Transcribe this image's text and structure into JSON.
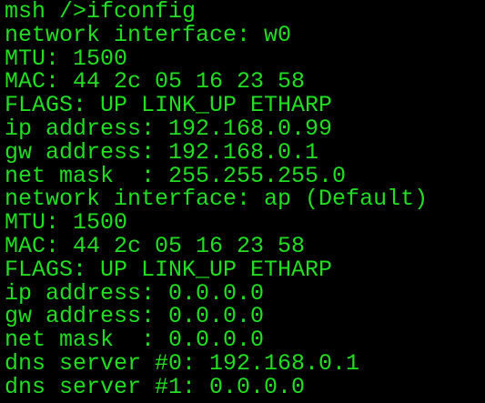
{
  "colors": {
    "background": "#000000",
    "text": "#22dd22"
  },
  "terminal": {
    "lines": [
      "msh />ifconfig",
      "network interface: w0",
      "MTU: 1500",
      "MAC: 44 2c 05 16 23 58",
      "FLAGS: UP LINK_UP ETHARP",
      "ip address: 192.168.0.99",
      "gw address: 192.168.0.1",
      "net mask  : 255.255.255.0",
      "network interface: ap (Default)",
      "MTU: 1500",
      "MAC: 44 2c 05 16 23 58",
      "FLAGS: UP LINK_UP ETHARP",
      "ip address: 0.0.0.0",
      "gw address: 0.0.0.0",
      "net mask  : 0.0.0.0",
      "dns server #0: 192.168.0.1",
      "dns server #1: 0.0.0.0"
    ]
  }
}
